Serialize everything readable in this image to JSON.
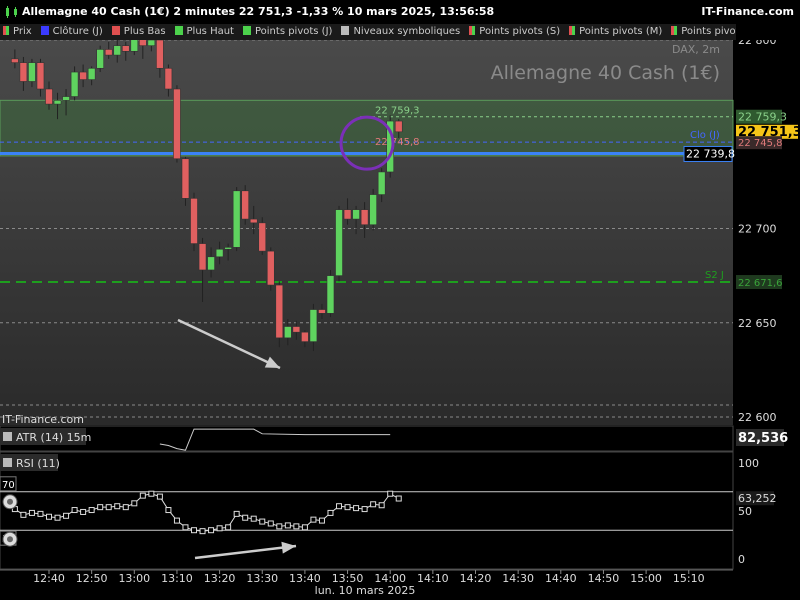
{
  "header": {
    "title": "Allemagne 40 Cash (1€) 2 minutes 22 751,3 -1,33 % 10 mars 2025, 13:56:58",
    "brand": "IT-Finance.com"
  },
  "legend": [
    {
      "label": "Prix",
      "color": "#e05050",
      "color2": "#4cd24c"
    },
    {
      "label": "Clôture (J)",
      "color": "#3b3bff"
    },
    {
      "label": "Plus Bas",
      "color": "#e05050"
    },
    {
      "label": "Plus Haut",
      "color": "#4cd24c"
    },
    {
      "label": "Points pivots (J)",
      "color": "#4cd24c"
    },
    {
      "label": "Niveaux symboliques",
      "color": "#bbbbbb"
    },
    {
      "label": "Points pivots (S)",
      "color": "#e05050",
      "color2": "#4cd24c"
    },
    {
      "label": "Points pivots (M)",
      "color": "#e05050",
      "color2": "#4cd24c"
    },
    {
      "label": "Points pivots (A)",
      "color": "#e05050",
      "color2": "#4cd24c"
    }
  ],
  "watermark": {
    "instrument": "Allemagne 40 Cash (1€)",
    "subtitle": "DAX, 2m",
    "source": "IT-Finance.com"
  },
  "colors": {
    "up": "#5fd35f",
    "down": "#e06060",
    "zone": "#3d6a3d",
    "close_line": "#3b82f6",
    "s2_line": "#1e9e1e",
    "arrow": "#cccccc",
    "circle": "#7b2fb8"
  },
  "chart_data": [
    {
      "type": "candlestick",
      "x_ticks": [
        "12:40",
        "12:50",
        "13:00",
        "13:10",
        "13:20",
        "13:30",
        "13:40",
        "13:50",
        "14:00",
        "14:10",
        "14:20",
        "14:30",
        "14:40",
        "14:50",
        "15:00",
        "15:10"
      ],
      "x_caption": "lun. 10 mars 2025",
      "y_ticks": [
        22800,
        22700,
        22650,
        22600
      ],
      "y_tick_labels": [
        "22 800",
        "22 700",
        "22 650",
        "22 600"
      ],
      "ylim": [
        22595,
        22805
      ],
      "series": [
        {
          "candles": [
            [
              "12:32",
              22790,
              22795,
              22785,
              22788
            ],
            [
              "12:34",
              22788,
              22791,
              22773,
              22778
            ],
            [
              "12:36",
              22778,
              22790,
              22775,
              22788
            ],
            [
              "12:38",
              22788,
              22790,
              22770,
              22774
            ],
            [
              "12:40",
              22774,
              22778,
              22763,
              22766
            ],
            [
              "12:42",
              22766,
              22772,
              22758,
              22768
            ],
            [
              "12:44",
              22768,
              22774,
              22760,
              22770
            ],
            [
              "12:46",
              22770,
              22786,
              22768,
              22783
            ],
            [
              "12:48",
              22783,
              22787,
              22775,
              22779
            ],
            [
              "12:50",
              22779,
              22786,
              22776,
              22785
            ],
            [
              "12:52",
              22785,
              22797,
              22783,
              22795
            ],
            [
              "12:54",
              22795,
              22799,
              22790,
              22792
            ],
            [
              "12:56",
              22792,
              22800,
              22788,
              22797
            ],
            [
              "12:58",
              22797,
              22799,
              22789,
              22794
            ],
            [
              "13:00",
              22794,
              22805,
              22792,
              22801
            ],
            [
              "13:02",
              22801,
              22804,
              22790,
              22797
            ],
            [
              "13:04",
              22797,
              22804,
              22794,
              22800
            ],
            [
              "13:06",
              22800,
              22802,
              22780,
              22785
            ],
            [
              "13:08",
              22785,
              22787,
              22770,
              22774
            ],
            [
              "13:10",
              22774,
              22776,
              22735,
              22737
            ],
            [
              "13:12",
              22737,
              22738,
              22712,
              22716
            ],
            [
              "13:14",
              22716,
              22719,
              22688,
              22692
            ],
            [
              "13:16",
              22692,
              22695,
              22661,
              22678
            ],
            [
              "13:18",
              22678,
              22690,
              22674,
              22685
            ],
            [
              "13:20",
              22685,
              22693,
              22681,
              22689
            ],
            [
              "13:22",
              22689,
              22692,
              22683,
              22690
            ],
            [
              "13:24",
              22690,
              22722,
              22688,
              22720
            ],
            [
              "13:26",
              22720,
              22723,
              22702,
              22705
            ],
            [
              "13:28",
              22705,
              22712,
              22697,
              22703
            ],
            [
              "13:30",
              22703,
              22706,
              22686,
              22688
            ],
            [
              "13:32",
              22688,
              22690,
              22667,
              22670
            ],
            [
              "13:34",
              22670,
              22672,
              22637,
              22642
            ],
            [
              "13:36",
              22642,
              22652,
              22638,
              22648
            ],
            [
              "13:38",
              22648,
              22651,
              22641,
              22645
            ],
            [
              "13:40",
              22645,
              22646,
              22637,
              22640
            ],
            [
              "13:42",
              22640,
              22660,
              22635,
              22657
            ],
            [
              "13:44",
              22657,
              22660,
              22652,
              22655
            ],
            [
              "13:46",
              22655,
              22678,
              22653,
              22675
            ],
            [
              "13:48",
              22675,
              22712,
              22672,
              22710
            ],
            [
              "13:50",
              22710,
              22716,
              22702,
              22705
            ],
            [
              "13:52",
              22705,
              22712,
              22697,
              22710
            ],
            [
              "13:54",
              22710,
              22714,
              22695,
              22702
            ],
            [
              "13:56",
              22702,
              22721,
              22699,
              22718
            ],
            [
              "13:58",
              22718,
              22732,
              22714,
              22730
            ],
            [
              "14:00",
              22730,
              22760,
              22727,
              22757
            ],
            [
              "14:02",
              22757,
              22758,
              22748,
              22751.3
            ]
          ]
        }
      ],
      "levels": [
        {
          "name": "Clo (J)",
          "value": 22745.8,
          "tag": "22 745,8"
        },
        {
          "name": "",
          "value": 22739.8,
          "tag": "22 739,8"
        },
        {
          "name": "S2 J",
          "value": 22671.6,
          "tag": "22 671,6"
        },
        {
          "name": "",
          "value": 22759.3,
          "tag": "22 759,3"
        }
      ],
      "zone": [
        22738.5,
        22768
      ],
      "last_price": {
        "value": 22751.3,
        "tag": "22 751,3"
      },
      "annotations": {
        "high_label": "22 759,3",
        "close_label": "22 745,8"
      }
    },
    {
      "type": "line",
      "title": "ATR (14) 15m",
      "last_value": "82,536",
      "series": [
        {
          "name": "ATR (14) 15m",
          "x": [
            "13:06",
            "13:08",
            "13:10",
            "13:12",
            "13:14",
            "13:20",
            "13:28",
            "13:30",
            "13:40",
            "13:50",
            "14:00"
          ],
          "values": [
            82.9,
            82.7,
            82.3,
            82.1,
            84.8,
            84.8,
            84.8,
            84.2,
            84.1,
            84.1,
            84.1
          ]
        }
      ],
      "ylim": [
        82,
        85.2
      ]
    },
    {
      "type": "line",
      "title": "RSI (11)",
      "last_value": "63,252",
      "y_ticks": [
        100,
        50,
        0
      ],
      "y_tick_labels": [
        "100",
        "50",
        "0"
      ],
      "levels": [
        {
          "value": 70,
          "tag": "70"
        },
        {
          "value": 30,
          "tag": "30"
        }
      ],
      "ylim": [
        0,
        100
      ],
      "series": [
        {
          "name": "RSI (11)",
          "x": [
            "12:32",
            "12:34",
            "12:36",
            "12:38",
            "12:40",
            "12:42",
            "12:44",
            "12:46",
            "12:48",
            "12:50",
            "12:52",
            "12:54",
            "12:56",
            "12:58",
            "13:00",
            "13:02",
            "13:04",
            "13:06",
            "13:08",
            "13:10",
            "13:12",
            "13:14",
            "13:16",
            "13:18",
            "13:20",
            "13:22",
            "13:24",
            "13:26",
            "13:28",
            "13:30",
            "13:32",
            "13:34",
            "13:36",
            "13:38",
            "13:40",
            "13:42",
            "13:44",
            "13:46",
            "13:48",
            "13:50",
            "13:52",
            "13:54",
            "13:56",
            "13:58",
            "14:00",
            "14:02"
          ],
          "values": [
            52,
            46,
            48,
            47,
            44,
            43,
            45,
            51,
            49,
            51,
            54,
            54,
            55,
            54,
            58,
            66,
            68,
            65,
            51,
            40,
            33,
            30,
            29,
            30,
            32,
            33,
            47,
            43,
            42,
            39,
            37,
            34,
            35,
            34,
            33,
            41,
            40,
            48,
            55,
            54,
            53,
            52,
            57,
            56,
            68,
            63
          ]
        }
      ]
    }
  ]
}
